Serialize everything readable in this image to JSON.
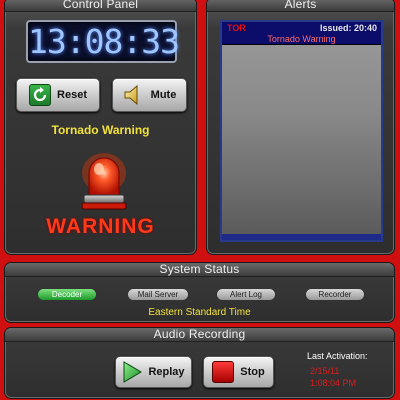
{
  "control_panel": {
    "title": "Control Panel",
    "clock": "13:08:33",
    "reset_label": "Reset",
    "mute_label": "Mute",
    "alert_text": "Tornado Warning",
    "warning_text": "WARNING"
  },
  "alerts": {
    "title": "Alerts",
    "items": [
      {
        "code": "TOR",
        "issued": "Issued: 20:40",
        "title": "Tornado Warning"
      }
    ]
  },
  "system_status": {
    "title": "System Status",
    "indicators": [
      {
        "label": "Decoder",
        "state": "on"
      },
      {
        "label": "Mail Server",
        "state": "off"
      },
      {
        "label": "Alert Log",
        "state": "off"
      },
      {
        "label": "Recorder",
        "state": "off"
      }
    ],
    "timezone": "Eastern Standard Time"
  },
  "audio_recording": {
    "title": "Audio Recording",
    "replay_label": "Replay",
    "stop_label": "Stop",
    "last_activation_label": "Last Activation:",
    "last_activation_date": "2/15/11",
    "last_activation_time": "1:08:04 PM"
  },
  "colors": {
    "background": "#d01010",
    "clock_digits": "#9fc6ff",
    "alert_yellow": "#f2e23a",
    "warning_red": "#ff3a1a",
    "indicator_on": "#1c9a2a"
  }
}
